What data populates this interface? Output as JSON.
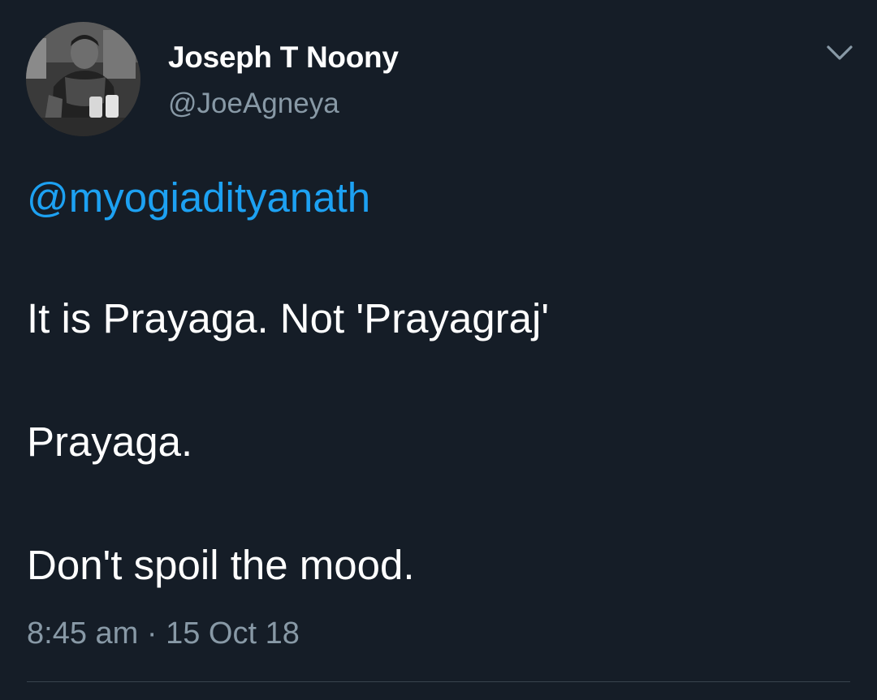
{
  "author": {
    "display_name": "Joseph T Noony",
    "handle": "@JoeAgneya"
  },
  "tweet": {
    "mention": "@myogiadityanath",
    "lines": [
      "It is Prayaga. Not 'Prayagraj'",
      "Prayaga.",
      "Don't spoil the mood."
    ],
    "time": "8:45 am",
    "separator": "·",
    "date": "15 Oct 18"
  },
  "icons": {
    "menu": "chevron-down-icon",
    "avatar": "profile-photo"
  },
  "colors": {
    "background": "#151d27",
    "text": "#ffffff",
    "secondary": "#8899a6",
    "link": "#1da1f2",
    "divider": "#38444d"
  }
}
